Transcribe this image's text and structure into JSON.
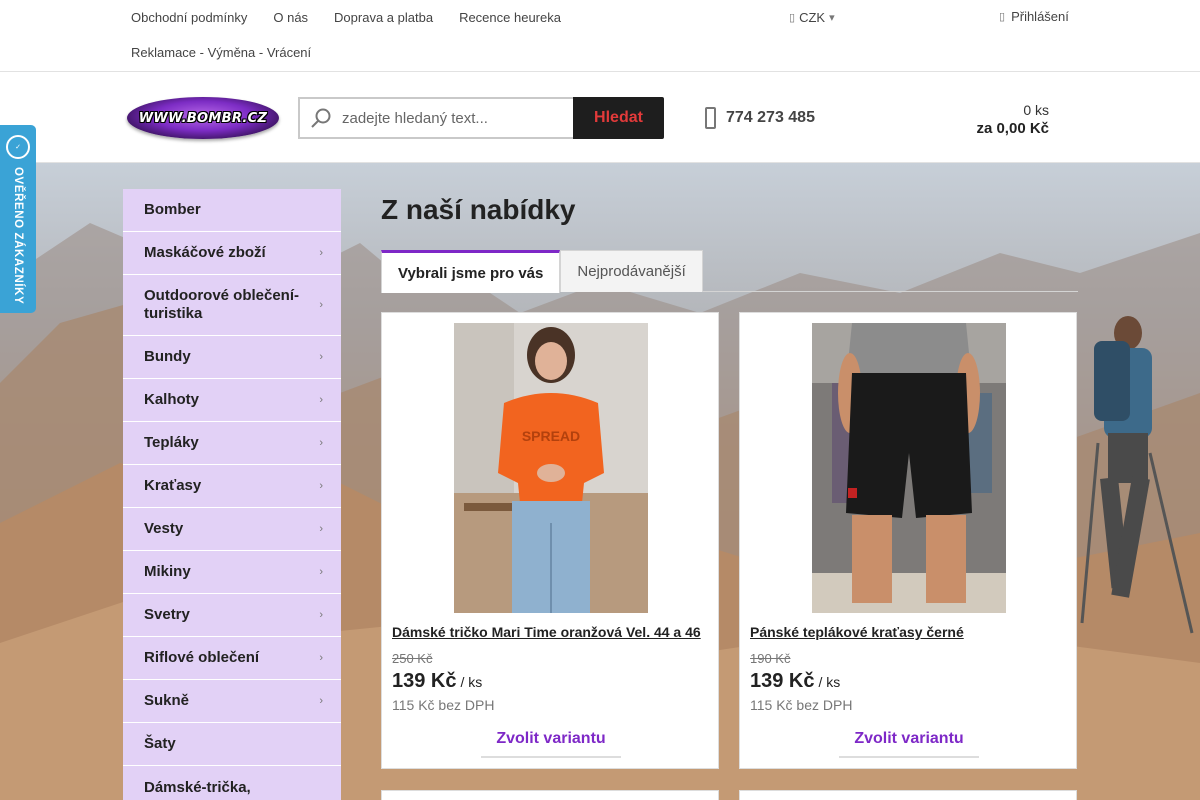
{
  "topbar": {
    "links": [
      "Obchodní podmínky",
      "O nás",
      "Doprava a platba",
      "Recence heureka",
      "Reklamace - Výměna - Vrácení"
    ],
    "currency": "CZK",
    "login": "Přihlášení"
  },
  "header": {
    "logo_text": "WWW.BOMBR.CZ",
    "search_placeholder": "zadejte hledaný text...",
    "search_button": "Hledat",
    "phone": "774 273 485",
    "cart_qty": "0 ks",
    "cart_sum": "za 0,00 Kč"
  },
  "badge": {
    "text": "OVĚŘENO ZÁKAZNÍKY"
  },
  "sidebar": {
    "items": [
      {
        "label": "Bomber",
        "arrow": false
      },
      {
        "label": "Maskáčové zboží",
        "arrow": true
      },
      {
        "label": "Outdoorové oblečení-turistika",
        "arrow": true
      },
      {
        "label": "Bundy",
        "arrow": true
      },
      {
        "label": "Kalhoty",
        "arrow": true
      },
      {
        "label": "Tepláky",
        "arrow": true
      },
      {
        "label": "Kraťasy",
        "arrow": true
      },
      {
        "label": "Vesty",
        "arrow": true
      },
      {
        "label": "Mikiny",
        "arrow": true
      },
      {
        "label": "Svetry",
        "arrow": true
      },
      {
        "label": "Riflové oblečení",
        "arrow": true
      },
      {
        "label": "Sukně",
        "arrow": true
      },
      {
        "label": "Šaty",
        "arrow": false
      },
      {
        "label": "Dámské-trička,",
        "arrow": false
      }
    ]
  },
  "main": {
    "heading": "Z naší nabídky",
    "tabs": [
      "Vybrali jsme pro vás",
      "Nejprodávanější"
    ],
    "products": [
      {
        "name": "Dámské tričko Mari Time oranžová Vel. 44 a 46",
        "old_price": "250 Kč",
        "price": "139 Kč",
        "unit": "/ ks",
        "net_price": "115 Kč bez DPH",
        "button": "Zvolit variantu"
      },
      {
        "name": "Pánské teplákové kraťasy černé",
        "old_price": "190 Kč",
        "price": "139 Kč",
        "unit": "/ ks",
        "net_price": "115 Kč bez DPH",
        "button": "Zvolit variantu"
      }
    ]
  },
  "colors": {
    "accent": "#7e28c7",
    "sidebar_bg": "#e2d1f6",
    "search_button_bg": "#1e1e1e",
    "search_button_text": "#e23a3a",
    "badge_bg": "#3aa3d6"
  }
}
